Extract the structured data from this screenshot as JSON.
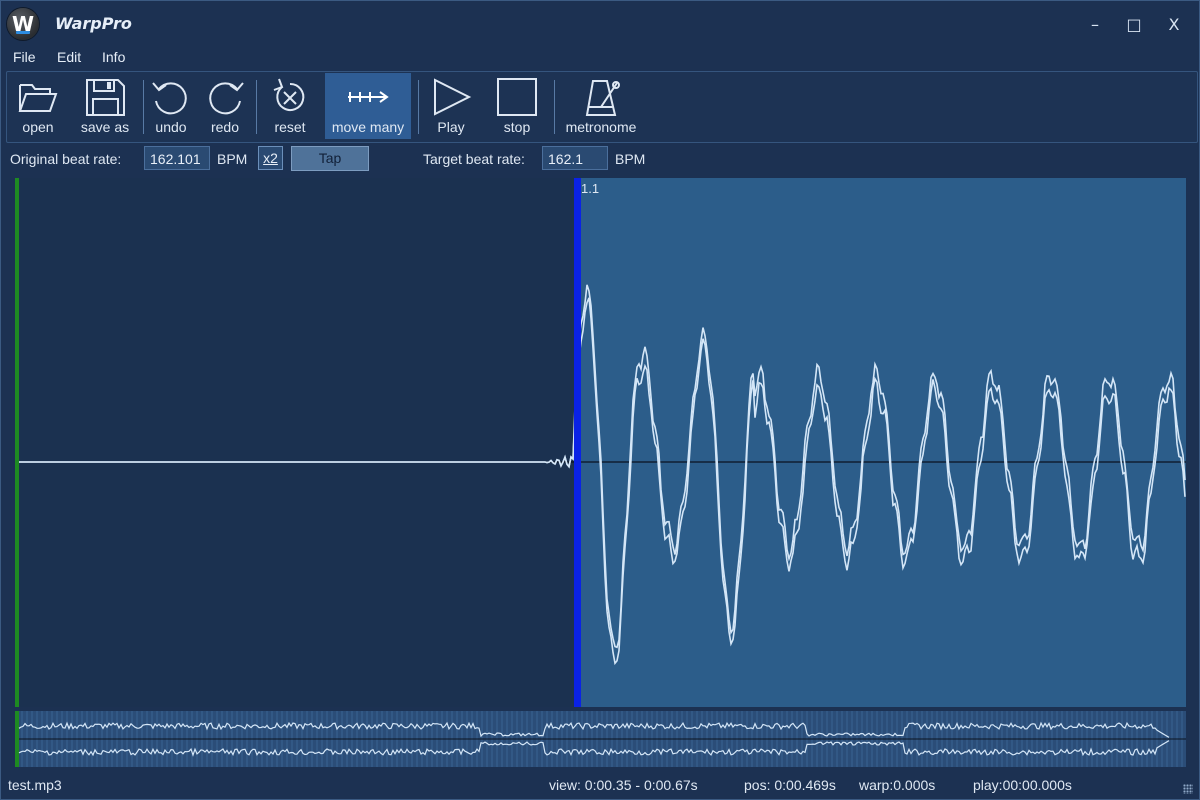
{
  "app": {
    "title": "WarpPro",
    "logo_letter": "W"
  },
  "window_controls": {
    "minimize": "–",
    "maximize": "□",
    "close": "X"
  },
  "menu": [
    "File",
    "Edit",
    "Info"
  ],
  "toolbar": {
    "open": "open",
    "save_as": "save as",
    "undo": "undo",
    "redo": "redo",
    "reset": "reset",
    "move_many": "move many",
    "play": "Play",
    "stop": "stop",
    "metronome": "metronome"
  },
  "beat": {
    "original_label": "Original beat rate:",
    "original_value": "162.101",
    "bpm_unit": "BPM",
    "x2_label": "x2",
    "tap_label": "Tap",
    "target_label": "Target beat rate:",
    "target_value": "162.1",
    "target_unit": "BPM"
  },
  "waveform": {
    "beat_marker_label": "1.1"
  },
  "status": {
    "file": "test.mp3",
    "view": "view: 0:00.35 - 0:00.67s",
    "pos": "pos: 0:00.469s",
    "warp": "warp:0.000s",
    "play": "play:00:00.000s"
  },
  "colors": {
    "background": "#1b3150",
    "selection": "#2c5d8a",
    "beat_marker": "#0a22e6",
    "start_marker": "#1e8a22",
    "wave": "#d4e6f7"
  }
}
